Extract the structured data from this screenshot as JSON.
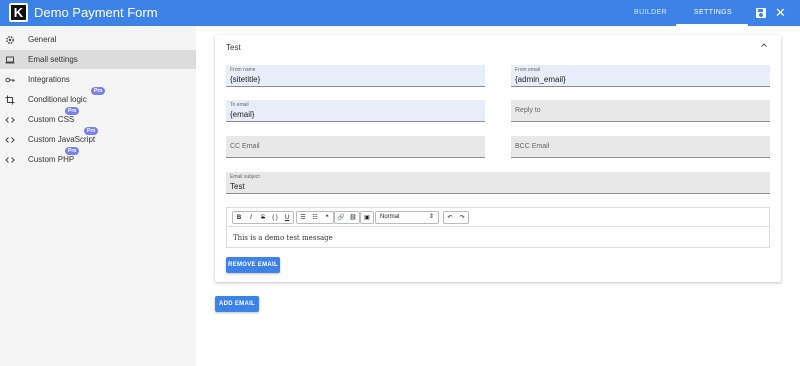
{
  "app": {
    "title": "Demo Payment Form",
    "logo_letter": "K"
  },
  "header": {
    "tabs": [
      {
        "label": "BUILDER"
      },
      {
        "label": "SETTINGS"
      }
    ],
    "close_glyph": "✕"
  },
  "sidebar": {
    "items": [
      {
        "label": "General",
        "icon": "gear-icon"
      },
      {
        "label": "Email settings",
        "icon": "laptop-icon"
      },
      {
        "label": "Integrations",
        "icon": "key-icon"
      },
      {
        "label": "Conditional logic",
        "icon": "crop-icon",
        "badge": "Pro"
      },
      {
        "label": "Custom CSS",
        "icon": "code-icon",
        "badge": "Pro"
      },
      {
        "label": "Custom JavaScript",
        "icon": "code-icon",
        "badge": "Pro"
      },
      {
        "label": "Custom PHP",
        "icon": "code-icon",
        "badge": "Pro"
      }
    ],
    "active_index": 1
  },
  "email_card": {
    "title": "Test",
    "fields": {
      "from_name": {
        "label": "From name",
        "value": "{sitetitle}"
      },
      "from_email": {
        "label": "From email",
        "value": "{admin_email}"
      },
      "to_email": {
        "label": "To email",
        "value": "{email}"
      },
      "reply_to": {
        "placeholder": "Reply to"
      },
      "cc_email": {
        "placeholder": "CC Email"
      },
      "bcc_email": {
        "placeholder": "BCC Email"
      },
      "email_subject": {
        "label": "Email subject",
        "value": "Test"
      }
    },
    "editor": {
      "format_select": "Normal",
      "toolbar": {
        "bold": "B",
        "italic": "I",
        "strike": "S",
        "code": "{ }",
        "underline": "U",
        "bullet_list": "☰",
        "ordered_list": "☷",
        "quote": "❝",
        "link": "🔗",
        "unlink": "⛓",
        "image": "▣",
        "undo": "↶",
        "redo": "↷"
      },
      "body": "This is a demo test message"
    },
    "remove_label": "REMOVE EMAIL"
  },
  "add_label": "ADD EMAIL"
}
